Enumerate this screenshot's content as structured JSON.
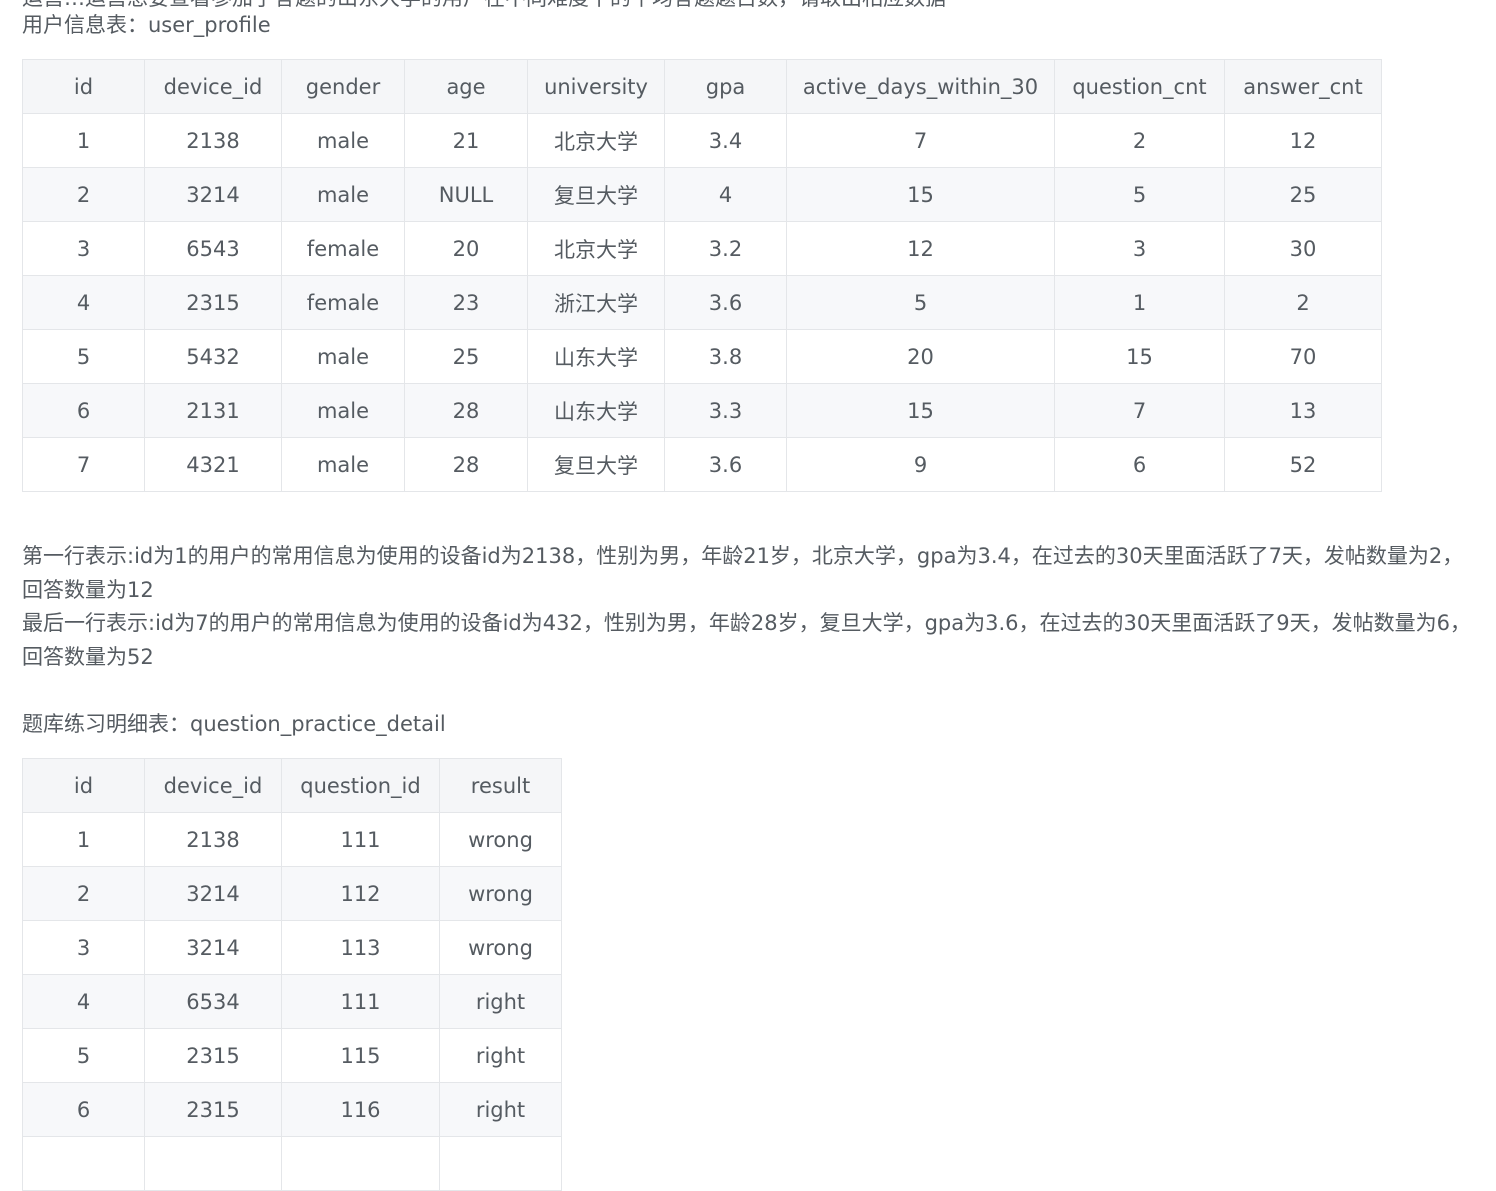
{
  "intro_cut_line": "运营…运营想要查看参加了答题的山东大学的用户在不同难度下的平均答题题目数，请取出相应数据",
  "table1": {
    "caption": "用户信息表：user_profile",
    "columns": [
      "id",
      "device_id",
      "gender",
      "age",
      "university",
      "gpa",
      "active_days_within_30",
      "question_cnt",
      "answer_cnt"
    ],
    "rows": [
      [
        "1",
        "2138",
        "male",
        "21",
        "北京大学",
        "3.4",
        "7",
        "2",
        "12"
      ],
      [
        "2",
        "3214",
        "male",
        "NULL",
        "复旦大学",
        "4",
        "15",
        "5",
        "25"
      ],
      [
        "3",
        "6543",
        "female",
        "20",
        "北京大学",
        "3.2",
        "12",
        "3",
        "30"
      ],
      [
        "4",
        "2315",
        "female",
        "23",
        "浙江大学",
        "3.6",
        "5",
        "1",
        "2"
      ],
      [
        "5",
        "5432",
        "male",
        "25",
        "山东大学",
        "3.8",
        "20",
        "15",
        "70"
      ],
      [
        "6",
        "2131",
        "male",
        "28",
        "山东大学",
        "3.3",
        "15",
        "7",
        "13"
      ],
      [
        "7",
        "4321",
        "male",
        "28",
        "复旦大学",
        "3.6",
        "9",
        "6",
        "52"
      ]
    ]
  },
  "description": {
    "first_row": "第一行表示:id为1的用户的常用信息为使用的设备id为2138，性别为男，年龄21岁，北京大学，gpa为3.4，在过去的30天里面活跃了7天，发帖数量为2，回答数量为12",
    "last_row": "最后一行表示:id为7的用户的常用信息为使用的设备id为432，性别为男，年龄28岁，复旦大学，gpa为3.6，在过去的30天里面活跃了9天，发帖数量为6，回答数量为52"
  },
  "table2": {
    "caption": "题库练习明细表：question_practice_detail",
    "columns": [
      "id",
      "device_id",
      "question_id",
      "result"
    ],
    "rows": [
      [
        "1",
        "2138",
        "111",
        "wrong"
      ],
      [
        "2",
        "3214",
        "112",
        "wrong"
      ],
      [
        "3",
        "3214",
        "113",
        "wrong"
      ],
      [
        "4",
        "6534",
        "111",
        "right"
      ],
      [
        "5",
        "2315",
        "115",
        "right"
      ],
      [
        "6",
        "2315",
        "116",
        "right"
      ],
      [
        "",
        "",
        "",
        ""
      ]
    ]
  }
}
